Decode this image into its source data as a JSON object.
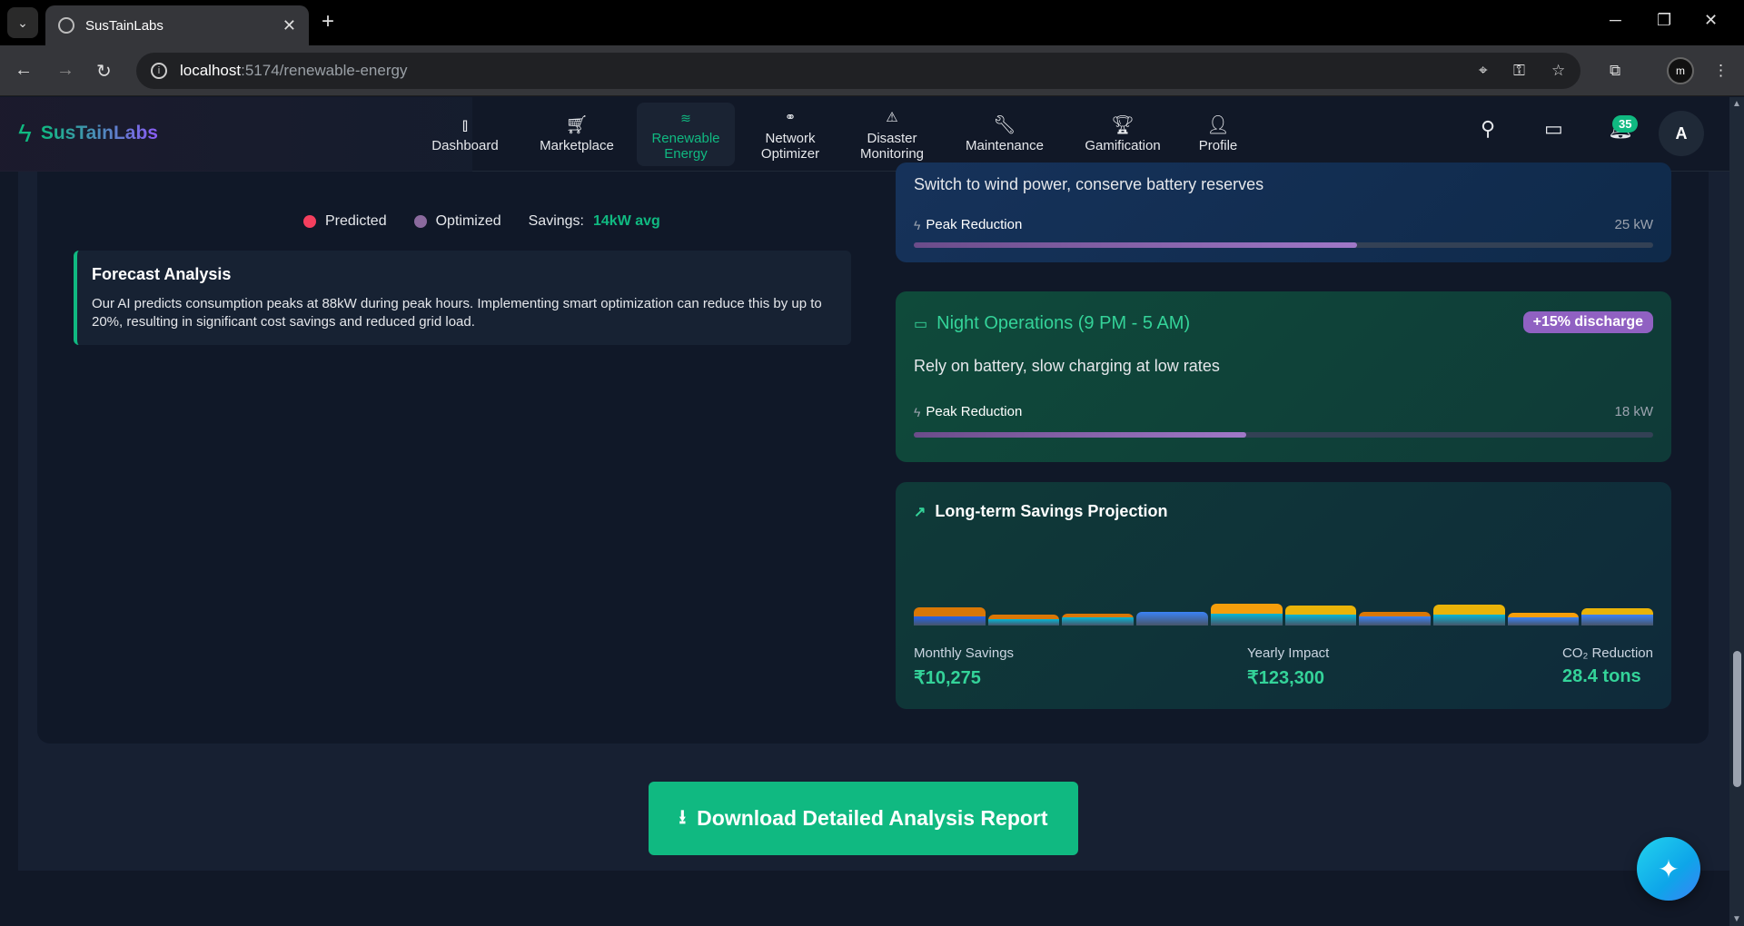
{
  "browser": {
    "tab_title": "SusTainLabs",
    "tab_close": "✕",
    "new_tab": "+",
    "url_host": "localhost",
    "url_path": ":5174/renewable-energy"
  },
  "header": {
    "brand": "SusTainLabs",
    "nav": [
      {
        "label": "Dashboard",
        "icon": "bar-chart-icon"
      },
      {
        "label": "Marketplace",
        "icon": "cart-icon"
      },
      {
        "label": "Renewable Energy",
        "icon": "wind-icon",
        "active": true
      },
      {
        "label": "Network Optimizer",
        "icon": "network-icon"
      },
      {
        "label": "Disaster Monitoring",
        "icon": "warning-icon"
      },
      {
        "label": "Maintenance",
        "icon": "wrench-icon"
      },
      {
        "label": "Gamification",
        "icon": "trophy-icon"
      },
      {
        "label": "Profile",
        "icon": "user-icon"
      }
    ],
    "notification_count": "35",
    "avatar_initial": "A"
  },
  "chart_legend": {
    "predicted": "Predicted",
    "optimized": "Optimized",
    "savings_label": "Savings:",
    "savings_value": "14kW avg",
    "predicted_color": "#f43f5e",
    "optimized_color": "#8b6a9e"
  },
  "forecast": {
    "title": "Forecast Analysis",
    "text": "Our AI predicts consumption peaks at 88kW during peak hours. Implementing smart optimization can reduce this by up to 20%, resulting in significant cost savings and reduced grid load."
  },
  "strategies": [
    {
      "description": "Switch to wind power, conserve battery reserves",
      "peak_label": "Peak Reduction",
      "peak_value": "25 kW",
      "progress": 0.6
    },
    {
      "title": "Night Operations (9 PM - 5 AM)",
      "badge": "+15% discharge",
      "description": "Rely on battery, slow charging at low rates",
      "peak_label": "Peak Reduction",
      "peak_value": "18 kW",
      "progress": 0.45
    }
  ],
  "projection": {
    "title": "Long-term Savings Projection",
    "monthly_label": "Monthly Savings",
    "monthly_value": "₹10,275",
    "yearly_label": "Yearly Impact",
    "yearly_value": "₹123,300",
    "co2_label": "CO₂ Reduction",
    "co2_value": "28.4 tons",
    "bars": [
      {
        "top": 0.38,
        "bottom": 0.38,
        "top_color": "#d97706",
        "bottom_color": "#2563eb"
      },
      {
        "top": 0.18,
        "bottom": 0.27,
        "top_color": "#d97706",
        "bottom_color": "#06b6d4"
      },
      {
        "top": 0.15,
        "bottom": 0.35,
        "top_color": "#d97706",
        "bottom_color": "#06b6d4"
      },
      {
        "top": 0.0,
        "bottom": 0.55,
        "top_color": "#d97706",
        "bottom_color": "#3b82f6"
      },
      {
        "top": 0.42,
        "bottom": 0.48,
        "top_color": "#f59e0b",
        "bottom_color": "#06b6d4"
      },
      {
        "top": 0.38,
        "bottom": 0.45,
        "top_color": "#eab308",
        "bottom_color": "#06b6d4"
      },
      {
        "top": 0.18,
        "bottom": 0.38,
        "top_color": "#d97706",
        "bottom_color": "#3b82f6"
      },
      {
        "top": 0.4,
        "bottom": 0.45,
        "top_color": "#eab308",
        "bottom_color": "#06b6d4"
      },
      {
        "top": 0.18,
        "bottom": 0.33,
        "top_color": "#f59e0b",
        "bottom_color": "#3b82f6"
      },
      {
        "top": 0.28,
        "bottom": 0.45,
        "top_color": "#eab308",
        "bottom_color": "#3b82f6"
      }
    ]
  },
  "download_button": "Download Detailed Analysis Report"
}
